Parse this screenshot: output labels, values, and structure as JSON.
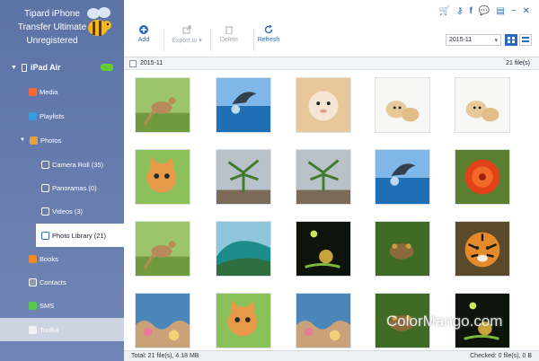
{
  "app": {
    "title_line1": "Tipard iPhone",
    "title_line2": "Transfer Ultimate",
    "title_line3": "Unregistered"
  },
  "sidebar": {
    "device": "iPad Air",
    "items": [
      {
        "label": "Media"
      },
      {
        "label": "Playlists"
      },
      {
        "label": "Photos"
      },
      {
        "label": "Camera Roll (35)"
      },
      {
        "label": "Panoramas (0)"
      },
      {
        "label": "Videos (3)"
      },
      {
        "label": "Photo Library (21)"
      },
      {
        "label": "Books"
      },
      {
        "label": "Contacts"
      },
      {
        "label": "SMS"
      },
      {
        "label": "Toolkit"
      }
    ]
  },
  "toolbar": {
    "add": "Add",
    "export": "Export to",
    "delete": "Delete",
    "refresh": "Refresh",
    "date_value": "2015-11"
  },
  "group": {
    "date": "2015-11",
    "count": "21 file(s)"
  },
  "status": {
    "total": "Total: 21 file(s), 4.18 MB",
    "checked": "Checked: 0 file(s), 0 B"
  },
  "watermark": "ColorMango.com",
  "thumbnails": [
    {
      "icon": "kangaroo-photo"
    },
    {
      "icon": "dolphin-photo"
    },
    {
      "icon": "hamster-photo"
    },
    {
      "icon": "puppies-photo"
    },
    {
      "icon": "puppies-photo"
    },
    {
      "icon": "cat-photo"
    },
    {
      "icon": "palm-plant-photo"
    },
    {
      "icon": "palm-plant-photo"
    },
    {
      "icon": "dolphin-photo"
    },
    {
      "icon": "red-flower-photo"
    },
    {
      "icon": "kangaroo-photo"
    },
    {
      "icon": "wave-photo"
    },
    {
      "icon": "snail-photo"
    },
    {
      "icon": "frog-photo"
    },
    {
      "icon": "tiger-photo"
    },
    {
      "icon": "coral-photo"
    },
    {
      "icon": "cat-photo"
    },
    {
      "icon": "coral-photo"
    },
    {
      "icon": "frog-photo"
    },
    {
      "icon": "snail-photo"
    }
  ]
}
